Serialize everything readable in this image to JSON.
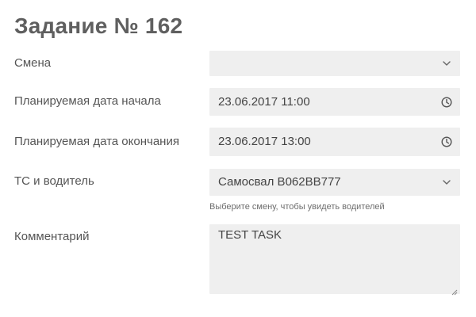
{
  "page": {
    "title": "Задание № 162"
  },
  "form": {
    "shift": {
      "label": "Смена",
      "value": "",
      "icon": "chevron-down-icon"
    },
    "planned_start": {
      "label": "Планируемая дата начала",
      "value": "23.06.2017 11:00",
      "icon": "clock-icon"
    },
    "planned_end": {
      "label": "Планируемая дата окончания",
      "value": "23.06.2017 13:00",
      "icon": "clock-icon"
    },
    "vehicle_driver": {
      "label": "ТС и водитель",
      "value": "Самосвал В062ВВ777",
      "helper_text": "Выберите смену, чтобы увидеть водителей",
      "icon": "chevron-down-icon"
    },
    "comment": {
      "label": "Комментарий",
      "value": "TEST TASK"
    }
  },
  "colors": {
    "field_background": "#efefef",
    "title": "#5f5f5f",
    "text": "#444444",
    "helper": "#6d6d6d"
  }
}
